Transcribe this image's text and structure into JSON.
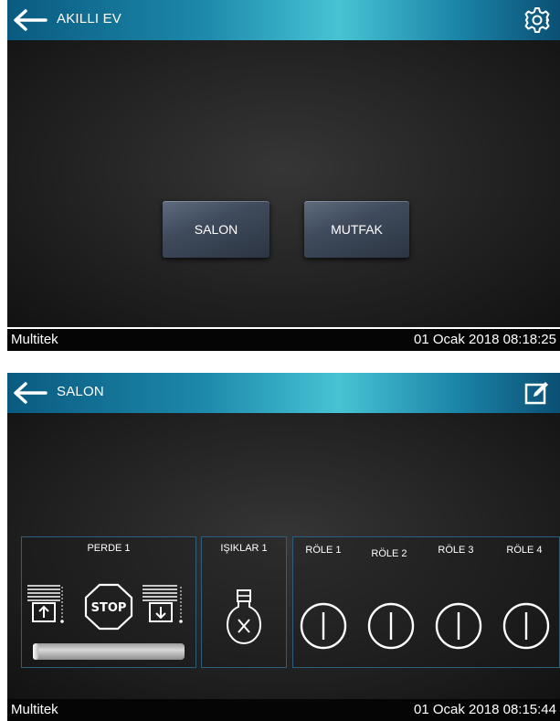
{
  "screen1": {
    "title": "AKILLI EV",
    "rooms": [
      {
        "label": "SALON"
      },
      {
        "label": "MUTFAK"
      }
    ],
    "status": {
      "brand": "Multitek",
      "datetime": "01 Ocak 2018 08:18:25"
    }
  },
  "screen2": {
    "title": "SALON",
    "curtain": {
      "label": "PERDE 1",
      "position": 0.0
    },
    "lights": {
      "label": "IŞIKLAR 1"
    },
    "relays": [
      {
        "label": "RÖLE 1"
      },
      {
        "label": "RÖLE 2"
      },
      {
        "label": "RÖLE 3"
      },
      {
        "label": "RÖLE 4"
      }
    ],
    "status": {
      "brand": "Multitek",
      "datetime": "01 Ocak 2018 08:15:44"
    }
  },
  "icons": [
    "back-arrow-icon",
    "gear-icon",
    "edit-icon",
    "blind-up-icon",
    "stop-icon",
    "blind-down-icon",
    "light-bulb-icon",
    "power-icon"
  ],
  "colors": {
    "topbar_accent": "#47c3d4",
    "panel_border": "#2d5f7c",
    "button_face": "#3f4b5c"
  }
}
